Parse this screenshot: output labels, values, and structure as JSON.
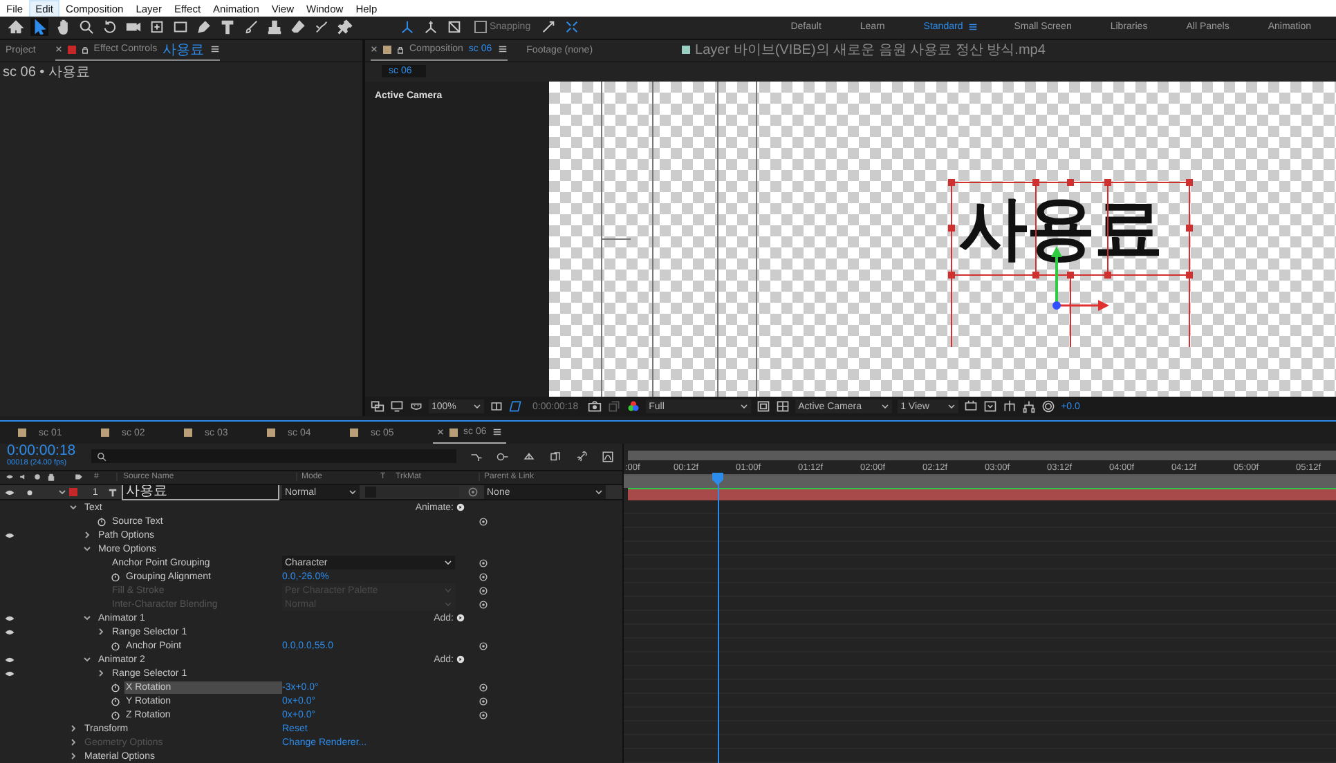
{
  "menu": [
    {
      "label": "File",
      "selected": false
    },
    {
      "label": "Edit",
      "selected": true
    },
    {
      "label": "Composition",
      "selected": false
    },
    {
      "label": "Layer",
      "selected": false
    },
    {
      "label": "Effect",
      "selected": false
    },
    {
      "label": "Animation",
      "selected": false
    },
    {
      "label": "View",
      "selected": false
    },
    {
      "label": "Window",
      "selected": false
    },
    {
      "label": "Help",
      "selected": false
    }
  ],
  "toolbar": {
    "snapping": {
      "label": "Snapping",
      "checked": false
    },
    "workspaces": [
      {
        "label": "Default",
        "selected": false
      },
      {
        "label": "Learn",
        "selected": false
      },
      {
        "label": "Standard",
        "selected": true
      },
      {
        "label": "Small Screen",
        "selected": false
      },
      {
        "label": "Libraries",
        "selected": false
      },
      {
        "label": "All Panels",
        "selected": false
      },
      {
        "label": "Animation",
        "selected": false
      }
    ]
  },
  "left_panel": {
    "tabs": [
      {
        "label": "Project",
        "selected": false
      },
      {
        "label": "Effect Controls",
        "subject": "사용료",
        "selected": true
      }
    ],
    "breadcrumb": "sc 06 • 사용료"
  },
  "viewer": {
    "tabs": [
      {
        "kind": "composition",
        "label": "Composition",
        "subject": "sc 06",
        "selected": true
      },
      {
        "kind": "footage",
        "label": "Footage (none)",
        "selected": false
      },
      {
        "kind": "layer",
        "label": "Layer 바이브(VIBE)의 새로운 음원 사용료 정산 방식.mp4",
        "selected": false
      }
    ],
    "comp_chip": "sc 06",
    "camera_label": "Active Camera",
    "canvas_text": "사용료",
    "bottom_bar": {
      "zoom": "100%",
      "timecode": "0:00:00:18",
      "resolution": "Full",
      "camera": "Active Camera",
      "views": "1 View",
      "exposure": "+0.0"
    }
  },
  "timeline": {
    "tabs": [
      {
        "label": "sc 01",
        "selected": false
      },
      {
        "label": "sc 02",
        "selected": false
      },
      {
        "label": "sc 03",
        "selected": false
      },
      {
        "label": "sc 04",
        "selected": false
      },
      {
        "label": "sc 05",
        "selected": false
      },
      {
        "label": "sc 06",
        "selected": true
      }
    ],
    "timecode": "0:00:00:18",
    "frame_info": "00018 (24.00 fps)",
    "columns": {
      "number": "#",
      "source_name": "Source Name",
      "mode": "Mode",
      "t": "T",
      "trkmat": "TrkMat",
      "parent": "Parent & Link"
    },
    "layer": {
      "number": "1",
      "name": "사용료",
      "mode": "Normal",
      "parent": "None",
      "expanded": true,
      "visible": true
    },
    "ruler": [
      ":00f",
      "00:12f",
      "01:00f",
      "01:12f",
      "02:00f",
      "02:12f",
      "03:00f",
      "03:12f",
      "04:00f",
      "04:12f",
      "05:00f",
      "05:12f"
    ],
    "playhead": {
      "level": 0.132
    },
    "properties": [
      {
        "kind": "group",
        "name": "Text",
        "expanded": true,
        "eye": false,
        "stopwatch": false,
        "pickwhip": false,
        "disabled": false,
        "selected": false,
        "action": "Animate:",
        "children": [
          {
            "kind": "property",
            "name": "Source Text",
            "eye": false,
            "stopwatch": true,
            "pickwhip": true,
            "disabled": false,
            "selected": false
          },
          {
            "kind": "group",
            "name": "Path Options",
            "expanded": false,
            "eye": true,
            "stopwatch": false,
            "pickwhip": false,
            "disabled": false,
            "selected": false
          },
          {
            "kind": "group",
            "name": "More Options",
            "expanded": true,
            "eye": false,
            "stopwatch": false,
            "pickwhip": false,
            "disabled": false,
            "selected": false,
            "children": [
              {
                "kind": "dropdown",
                "name": "Anchor Point Grouping",
                "value": "Character",
                "eye": false,
                "stopwatch": false,
                "pickwhip": true,
                "disabled": false,
                "selected": false
              },
              {
                "kind": "number",
                "name": "Grouping Alignment",
                "value": "0.0,-26.0%",
                "eye": false,
                "stopwatch": true,
                "pickwhip": true,
                "disabled": false,
                "selected": false
              },
              {
                "kind": "dropdown",
                "name": "Fill & Stroke",
                "value": "Per Character Palette",
                "eye": false,
                "stopwatch": false,
                "pickwhip": true,
                "disabled": true,
                "selected": false
              },
              {
                "kind": "dropdown",
                "name": "Inter-Character Blending",
                "value": "Normal",
                "eye": false,
                "stopwatch": false,
                "pickwhip": true,
                "disabled": true,
                "selected": false
              }
            ]
          },
          {
            "kind": "group",
            "name": "Animator 1",
            "expanded": true,
            "eye": true,
            "stopwatch": false,
            "pickwhip": false,
            "disabled": false,
            "selected": false,
            "action": "Add:",
            "children": [
              {
                "kind": "group",
                "name": "Range Selector 1",
                "expanded": false,
                "eye": true,
                "stopwatch": false,
                "pickwhip": false,
                "disabled": false,
                "selected": false
              },
              {
                "kind": "number",
                "name": "Anchor Point",
                "value": "0.0,0.0,55.0",
                "eye": false,
                "stopwatch": true,
                "pickwhip": true,
                "disabled": false,
                "selected": false
              }
            ]
          },
          {
            "kind": "group",
            "name": "Animator 2",
            "expanded": true,
            "eye": true,
            "stopwatch": false,
            "pickwhip": false,
            "disabled": false,
            "selected": false,
            "action": "Add:",
            "children": [
              {
                "kind": "group",
                "name": "Range Selector 1",
                "expanded": false,
                "eye": true,
                "stopwatch": false,
                "pickwhip": false,
                "disabled": false,
                "selected": false
              },
              {
                "kind": "number",
                "name": "X Rotation",
                "value": "-3x+0.0°",
                "eye": false,
                "stopwatch": true,
                "pickwhip": true,
                "disabled": false,
                "selected": true
              },
              {
                "kind": "number",
                "name": "Y Rotation",
                "value": "0x+0.0°",
                "eye": false,
                "stopwatch": true,
                "pickwhip": true,
                "disabled": false,
                "selected": false
              },
              {
                "kind": "number",
                "name": "Z Rotation",
                "value": "0x+0.0°",
                "eye": false,
                "stopwatch": true,
                "pickwhip": true,
                "disabled": false,
                "selected": false
              }
            ]
          }
        ]
      },
      {
        "kind": "group",
        "name": "Transform",
        "expanded": false,
        "eye": false,
        "stopwatch": false,
        "pickwhip": false,
        "disabled": false,
        "selected": false,
        "link": "Reset"
      },
      {
        "kind": "group",
        "name": "Geometry Options",
        "expanded": false,
        "eye": false,
        "stopwatch": false,
        "pickwhip": false,
        "disabled": true,
        "selected": false,
        "link": "Change Renderer..."
      },
      {
        "kind": "group",
        "name": "Material Options",
        "expanded": false,
        "eye": false,
        "stopwatch": false,
        "pickwhip": false,
        "disabled": false,
        "selected": false
      }
    ]
  }
}
